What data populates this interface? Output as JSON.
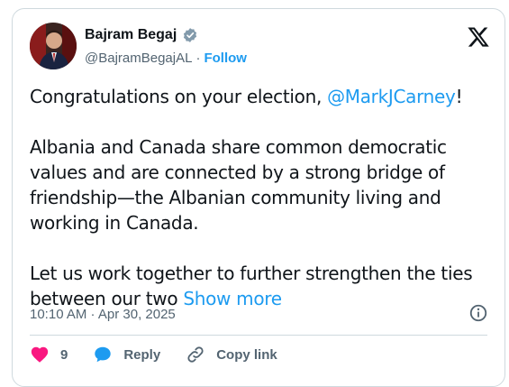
{
  "author": {
    "display_name": "Bajram Begaj",
    "handle": "@BajramBegajAL",
    "separator": "·",
    "follow_label": "Follow"
  },
  "tweet": {
    "para1_prefix": "Congratulations on your election, ",
    "para1_mention": "@MarkJCarney",
    "para1_suffix": "!",
    "para2": "Albania and Canada share common democratic values and are connected by a strong bridge of friendship—the Albanian community living and working in Canada.",
    "para3": "Let us work together to further strengthen the ties between our two ",
    "show_more_label": "Show more",
    "timestamp": "10:10 AM · Apr 30, 2025"
  },
  "actions": {
    "like_count": "9",
    "reply_label": "Reply",
    "copy_link_label": "Copy link"
  },
  "icons": {
    "verified": "verified-badge-icon",
    "logo": "x-logo-icon",
    "info": "info-icon",
    "like": "heart-icon",
    "reply": "speech-bubble-icon",
    "copy": "link-icon"
  },
  "colors": {
    "accent": "#1d9bf0",
    "like": "#f91880",
    "secondary_text": "#536471",
    "border": "#cfd9de"
  }
}
